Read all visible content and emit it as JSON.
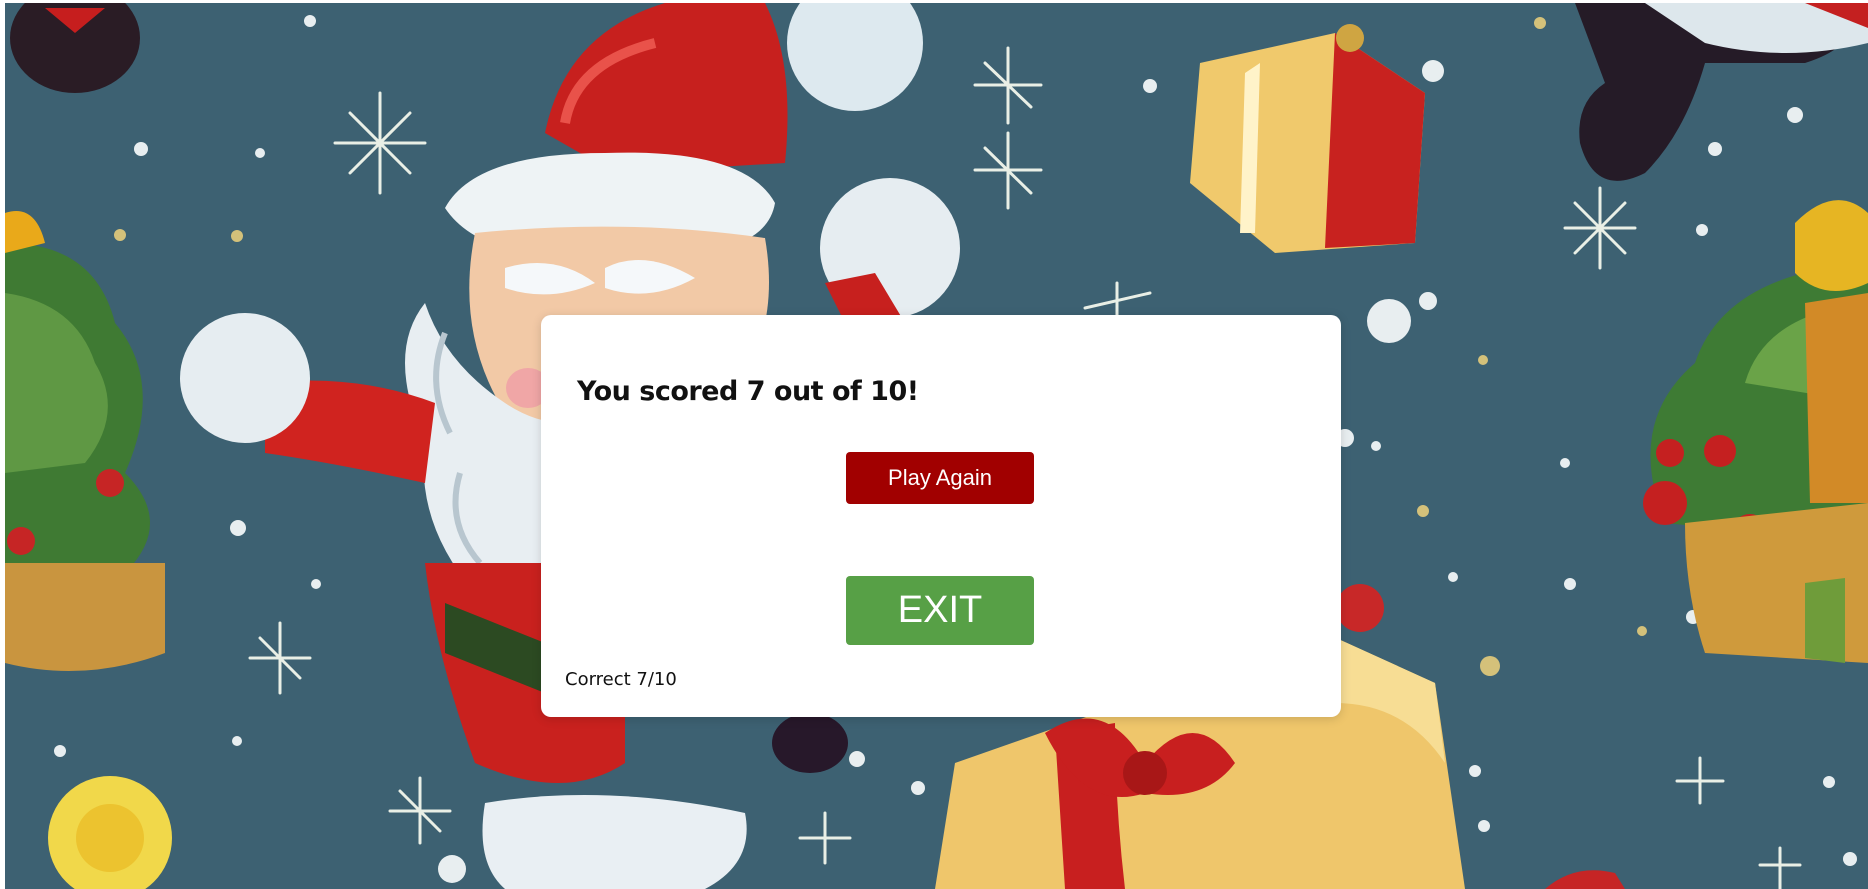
{
  "result": {
    "title": "You scored 7 out of 10!",
    "correct_label": "Correct 7/10",
    "score": 7,
    "total": 10
  },
  "buttons": {
    "play_again": "Play Again",
    "exit": "EXIT"
  },
  "colors": {
    "background_blue": "#3d6172",
    "play_again_red": "#a10000",
    "exit_green": "#57a046",
    "modal_white": "#ffffff"
  },
  "background": {
    "theme": "christmas-santa-presents-illustration"
  }
}
